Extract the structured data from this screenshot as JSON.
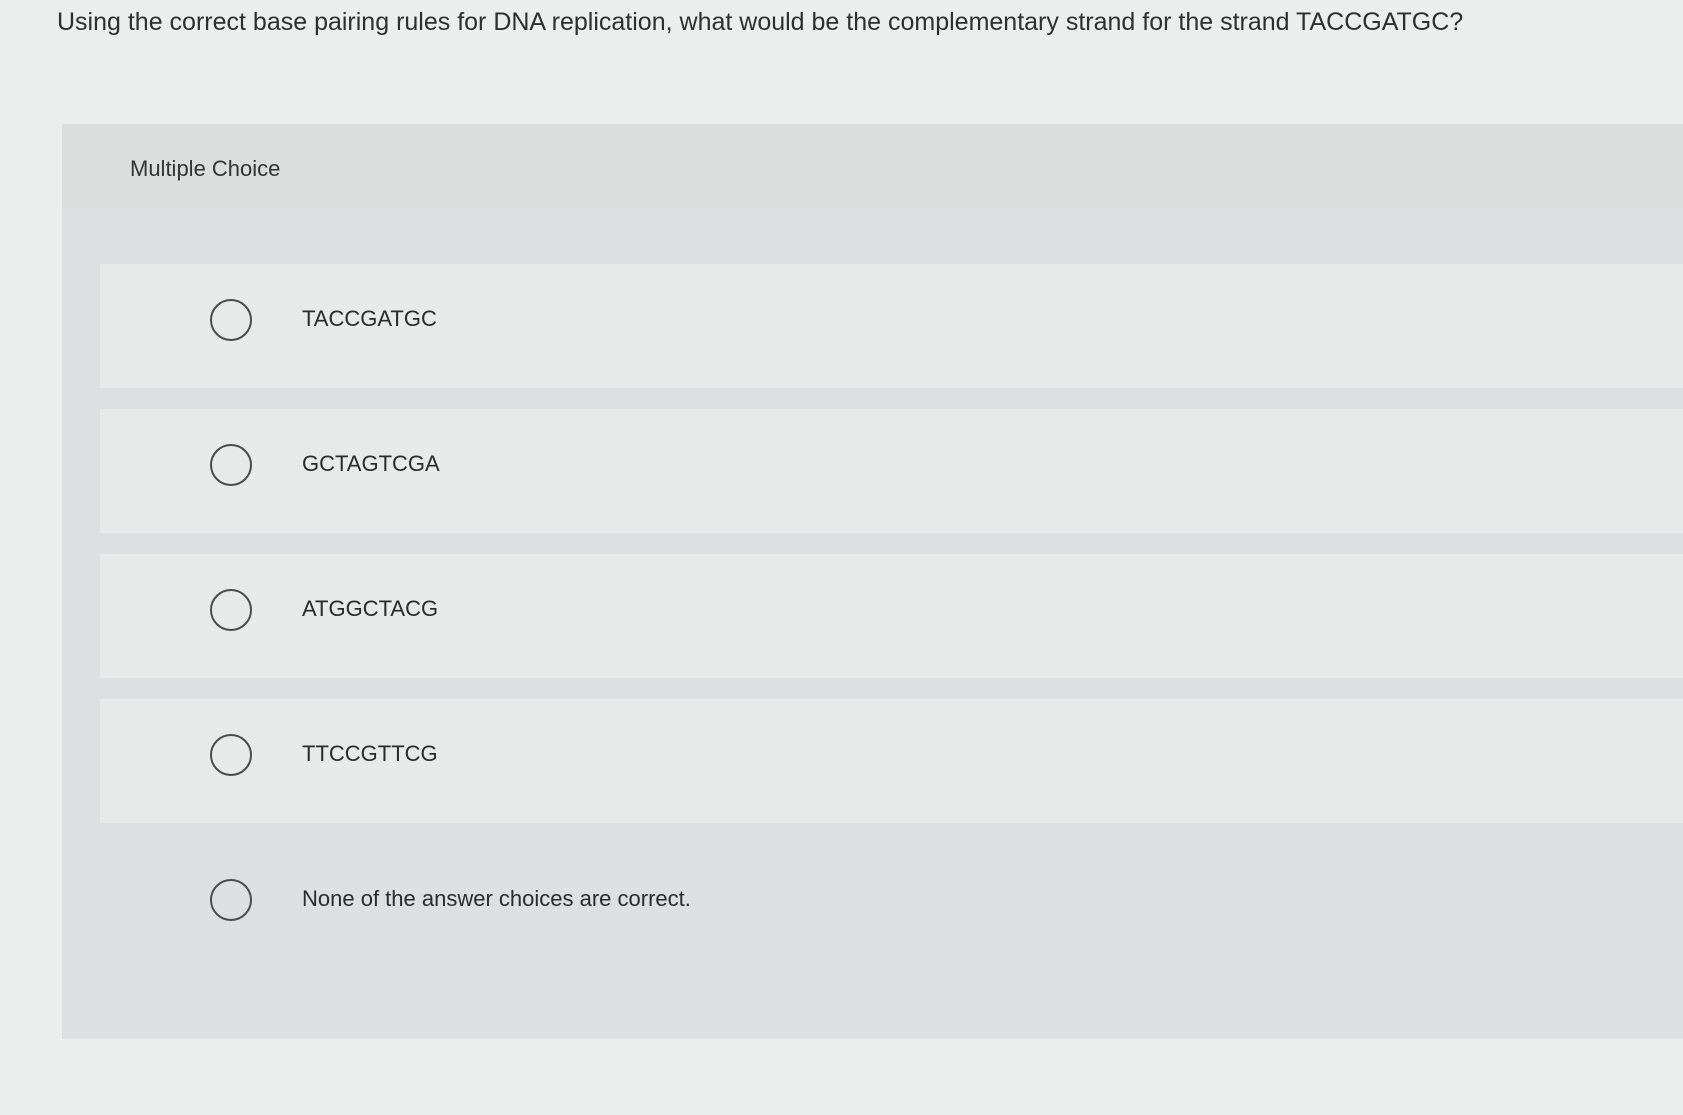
{
  "question": {
    "text": "Using the correct base pairing rules for DNA replication, what would be the complementary strand for the strand TACCGATGC?"
  },
  "panel": {
    "type_label": "Multiple Choice"
  },
  "choices": [
    {
      "label": "TACCGATGC"
    },
    {
      "label": "GCTAGTCGA"
    },
    {
      "label": "ATGGCTACG"
    },
    {
      "label": "TTCCGTTCG"
    },
    {
      "label": "None of the answer choices are correct."
    }
  ],
  "colors": {
    "background": "#eceded",
    "panel": "#dedfe0",
    "choice_row": "#e8e9e9",
    "text": "#2b2b2b"
  }
}
